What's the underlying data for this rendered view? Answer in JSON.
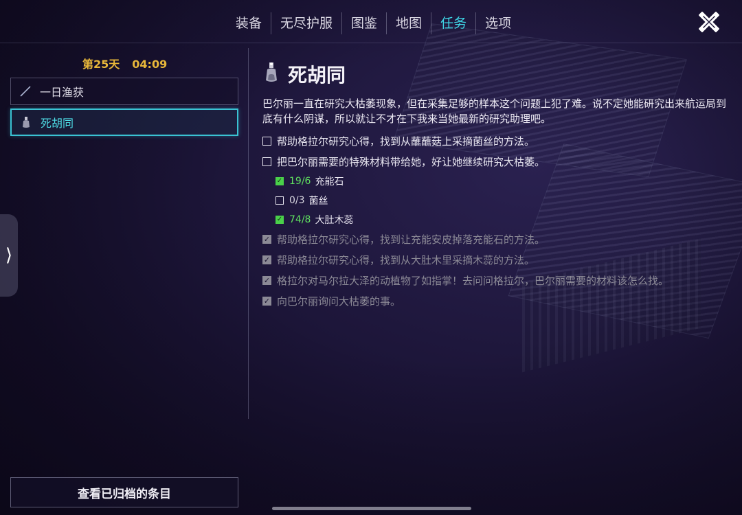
{
  "nav": {
    "tabs": [
      {
        "label": "装备"
      },
      {
        "label": "无尽护服"
      },
      {
        "label": "图鉴"
      },
      {
        "label": "地图"
      },
      {
        "label": "任务"
      },
      {
        "label": "选项"
      }
    ],
    "active_tab": "任务",
    "close_icon": "close-x-icon"
  },
  "status": {
    "day": "第25天",
    "time": "04:09"
  },
  "quest_list": [
    {
      "label": "一日渔获",
      "icon": "fishing-rod-icon"
    },
    {
      "label": "死胡同",
      "icon": "potion-bottle-icon"
    }
  ],
  "archive_button": "查看已归档的条目",
  "side_toggle": "⟩",
  "detail": {
    "title": "死胡同",
    "description": "巴尔丽一直在研究大枯萎现象，但在采集足够的样本这个问题上犯了难。说不定她能研究出来航运局到底有什么阴谋，所以就让不才在下我来当她最新的研究助理吧。",
    "objectives": [
      {
        "text": "帮助格拉尔研究心得，找到从蘸蘸菇上采摘菌丝的方法。",
        "done": false
      },
      {
        "text": "把巴尔丽需要的特殊材料带给她，好让她继续研究大枯萎。",
        "done": false
      }
    ],
    "materials": [
      {
        "count": "19/6",
        "name": "充能石",
        "done": true
      },
      {
        "count": "0/3",
        "name": "菌丝",
        "done": false
      },
      {
        "count": "74/8",
        "name": "大肚木蕊",
        "done": true
      }
    ],
    "completed": [
      {
        "text": "帮助格拉尔研究心得，找到让充能安皮掉落充能石的方法。"
      },
      {
        "text": "帮助格拉尔研究心得，找到从大肚木里采摘木蕊的方法。"
      },
      {
        "text": "格拉尔对马尔拉大泽的动植物了如指掌！去问问格拉尔，巴尔丽需要的材料该怎么找。"
      },
      {
        "text": "向巴尔丽询问大枯萎的事。"
      }
    ]
  },
  "colors": {
    "accent": "#3fd6e6",
    "day_gold": "#e8b73a",
    "complete_green": "#5fe05f",
    "done_grey": "#8c8a96"
  }
}
